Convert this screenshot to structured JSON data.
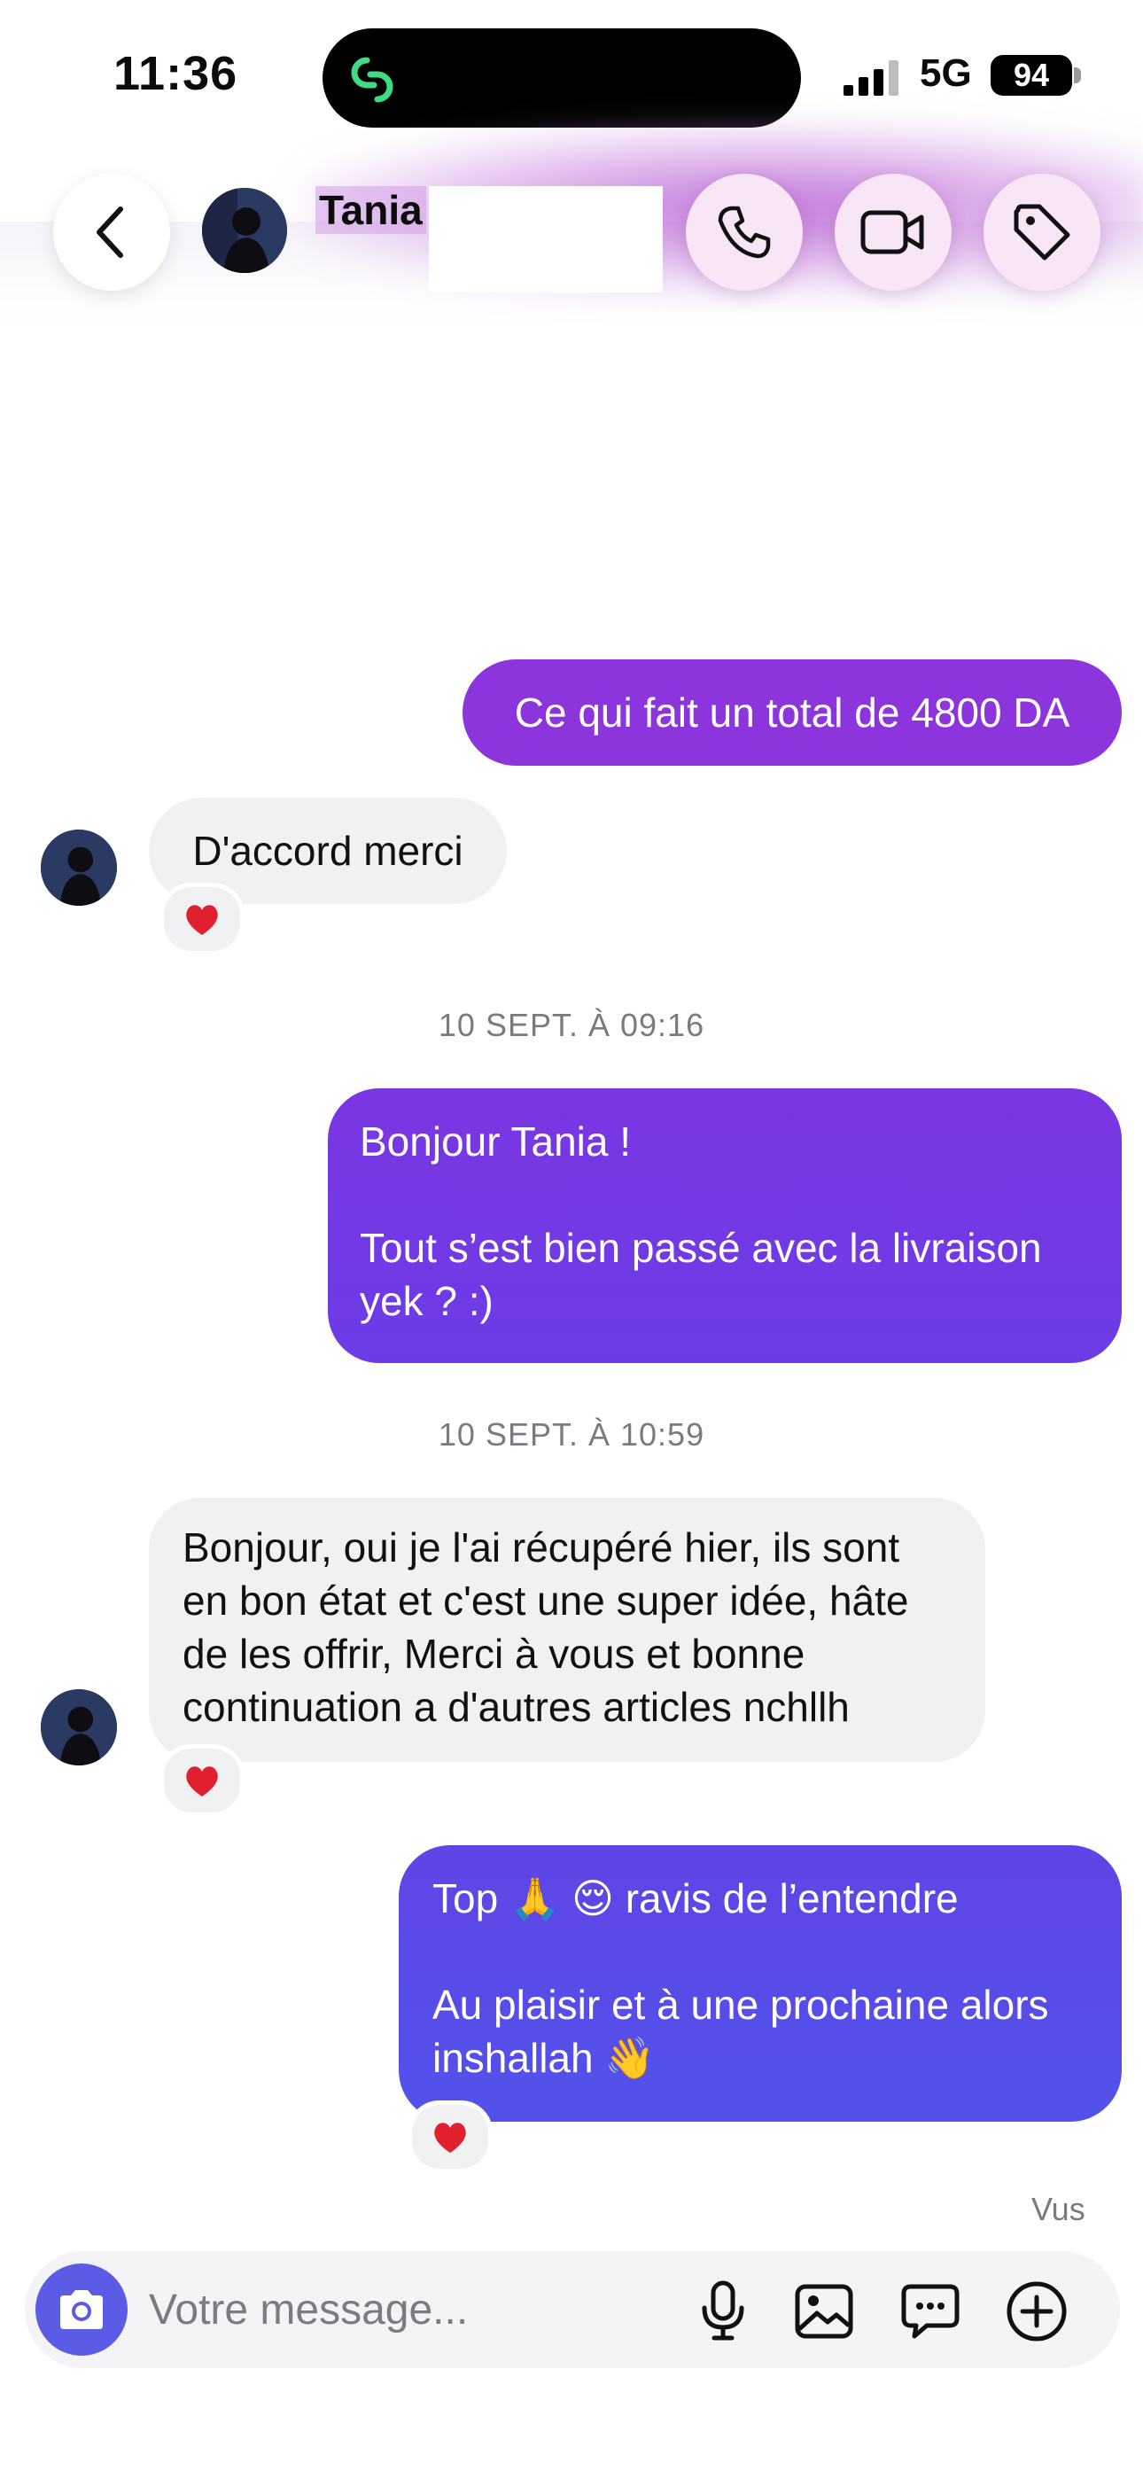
{
  "status_bar": {
    "time": "11:36",
    "network": "5G",
    "battery": "94"
  },
  "header": {
    "contact_name": "Tania"
  },
  "messages": [
    {
      "direction": "outgoing",
      "text": "Ce qui fait un total de 4800 DA"
    },
    {
      "direction": "incoming",
      "text": "D'accord merci",
      "reaction": "heart"
    },
    {
      "type": "timestamp",
      "text": "10 SEPT. À 09:16"
    },
    {
      "direction": "outgoing",
      "text": "Bonjour Tania !\n\nTout s’est bien passé avec la livraison yek ? :)"
    },
    {
      "type": "timestamp",
      "text": "10 SEPT. À 10:59"
    },
    {
      "direction": "incoming",
      "text": "Bonjour, oui je l'ai récupéré hier, ils sont en bon état et c'est une super idée, hâte de les offrir, Merci à vous et bonne continuation a d'autres articles nchllh",
      "reaction": "heart"
    },
    {
      "direction": "outgoing",
      "text": "Top 🙏 😌 ravis de l’entendre\n\nAu plaisir et à une prochaine alors inshallah 👋",
      "reaction": "heart"
    }
  ],
  "seen_label": "Vus",
  "composer": {
    "placeholder": "Votre message...",
    "value": ""
  },
  "colors": {
    "accent": "#8d35dc",
    "outgoing_gradient_end": "#5252ea",
    "camera_button": "#5b5be6",
    "incoming_bubble": "#f1f1f4"
  },
  "icons": [
    "back-chevron-icon",
    "phone-icon",
    "video-camera-icon",
    "tag-icon",
    "camera-icon",
    "microphone-icon",
    "image-icon",
    "sticker-icon",
    "plus-circle-icon",
    "heart-icon",
    "app-logo-icon"
  ]
}
